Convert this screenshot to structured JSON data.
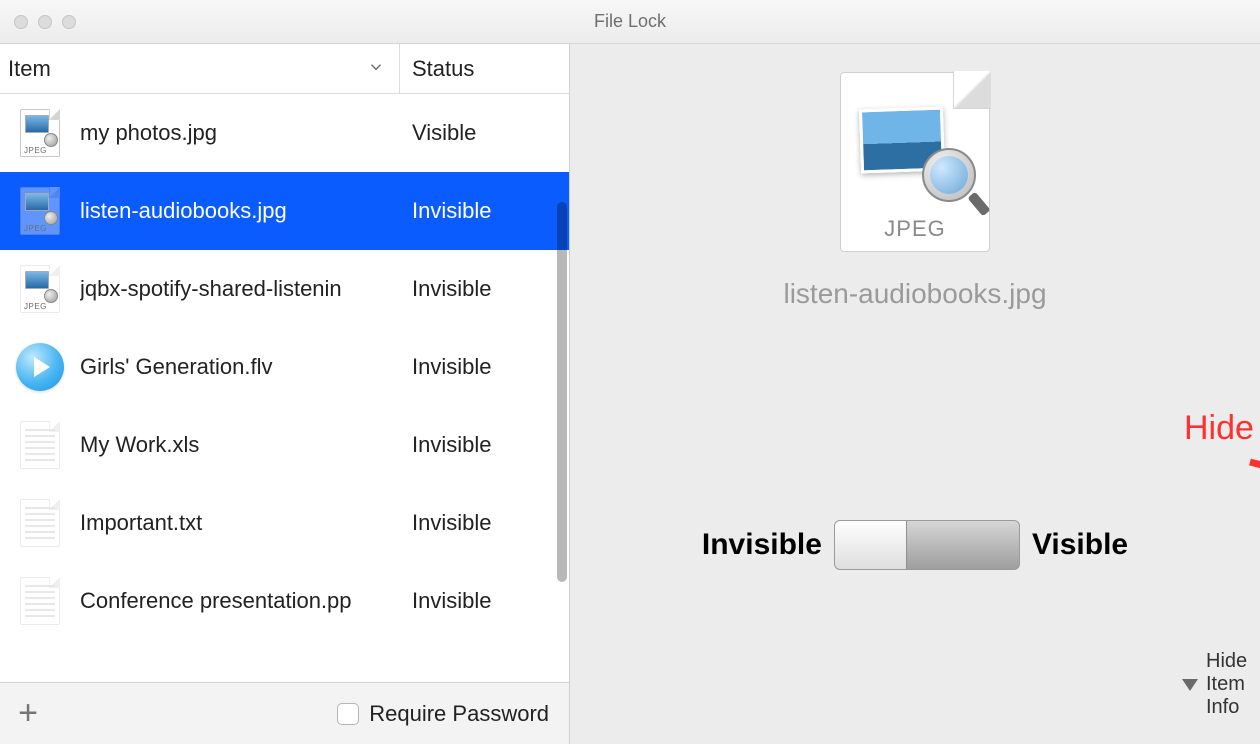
{
  "window": {
    "title": "File Lock"
  },
  "columns": {
    "item": "Item",
    "status": "Status"
  },
  "files": [
    {
      "name": "my photos.jpg",
      "status": "Visible",
      "icon": "jpeg",
      "selected": false,
      "dim": false
    },
    {
      "name": "listen-audiobooks.jpg",
      "status": "Invisible",
      "icon": "jpeg",
      "selected": true,
      "dim": true
    },
    {
      "name": "jqbx-spotify-shared-listenin",
      "status": "Invisible",
      "icon": "jpeg",
      "selected": false,
      "dim": true
    },
    {
      "name": "Girls' Generation.flv",
      "status": "Invisible",
      "icon": "flv",
      "selected": false,
      "dim": false
    },
    {
      "name": "My Work.xls",
      "status": "Invisible",
      "icon": "xls",
      "selected": false,
      "dim": true
    },
    {
      "name": "Important.txt",
      "status": "Invisible",
      "icon": "txt",
      "selected": false,
      "dim": true
    },
    {
      "name": "Conference presentation.pp",
      "status": "Invisible",
      "icon": "pp",
      "selected": false,
      "dim": true
    }
  ],
  "footer": {
    "require_password": "Require Password"
  },
  "detail": {
    "icon_caption": "JPEG",
    "filename": "listen-audiobooks.jpg",
    "label_invisible": "Invisible",
    "label_visible": "Visible",
    "disclosure": "Hide Item Info"
  },
  "annotation": {
    "label": "Hide"
  }
}
